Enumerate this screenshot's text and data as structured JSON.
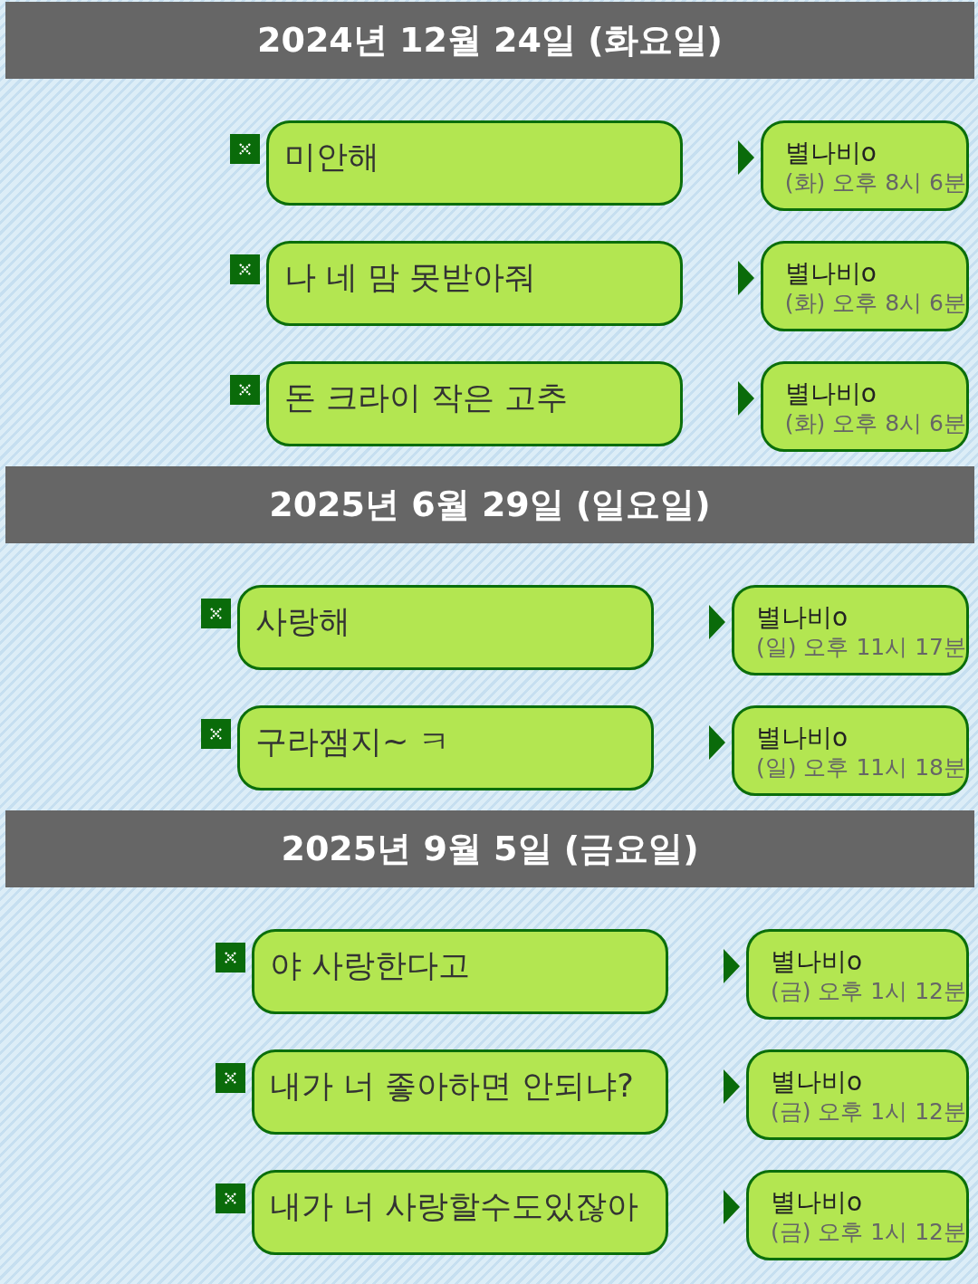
{
  "groups": [
    {
      "date": "2024년 12월 24일 (화요일)",
      "messages": [
        {
          "text": "미안해",
          "sender": "별나비o",
          "time": "(화) 오후 8시 6분"
        },
        {
          "text": "나 네 맘 못받아줘",
          "sender": "별나비o",
          "time": "(화) 오후 8시 6분"
        },
        {
          "text": "돈 크라이 작은 고추",
          "sender": "별나비o",
          "time": "(화) 오후 8시 6분"
        }
      ]
    },
    {
      "date": "2025년 6월 29일 (일요일)",
      "messages": [
        {
          "text": "사랑해",
          "sender": "별나비o",
          "time": "(일) 오후 11시 17분"
        },
        {
          "text": "구라잼지~ ㅋ",
          "sender": "별나비o",
          "time": "(일) 오후 11시 18분"
        }
      ]
    },
    {
      "date": "2025년 9월 5일 (금요일)",
      "messages": [
        {
          "text": "야 사랑한다고",
          "sender": "별나비o",
          "time": "(금) 오후 1시 12분"
        },
        {
          "text": "내가 너 좋아하면 안되냐?",
          "sender": "별나비o",
          "time": "(금) 오후 1시 12분"
        },
        {
          "text": "내가 너 사랑할수도있잖아",
          "sender": "별나비o",
          "time": "(금) 오후 1시 12분"
        }
      ]
    }
  ]
}
